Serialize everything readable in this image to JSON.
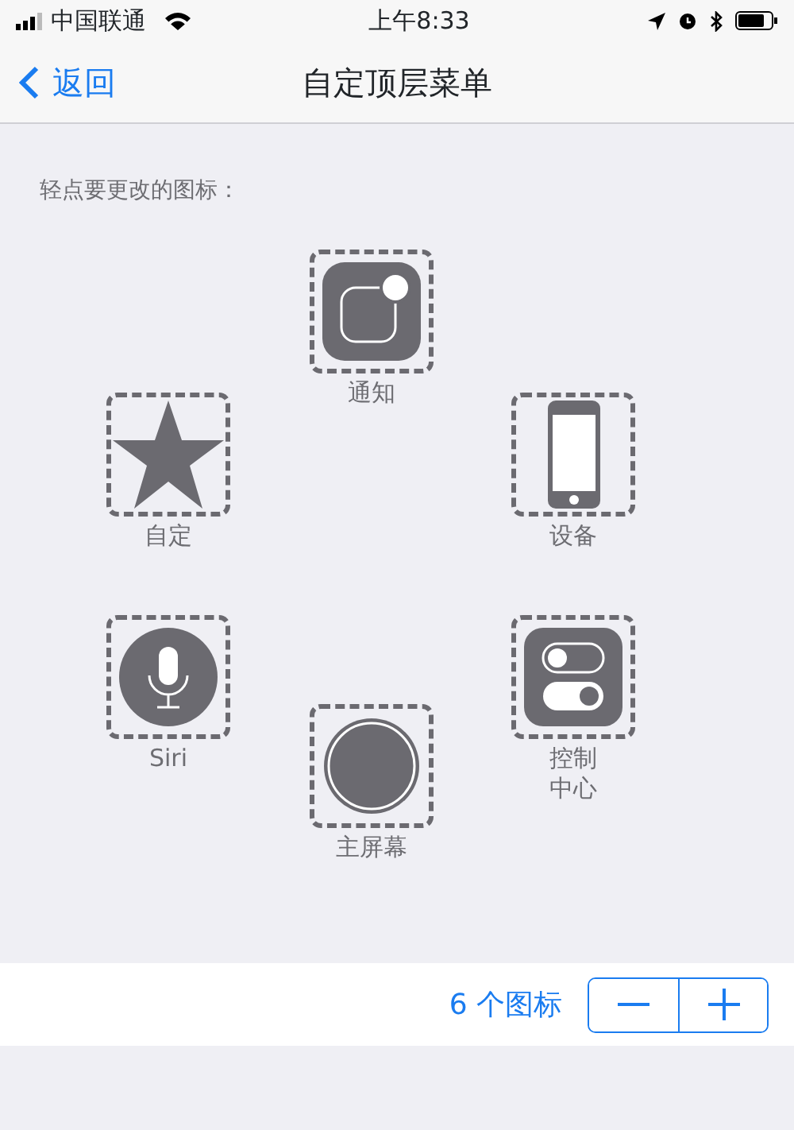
{
  "status_bar": {
    "carrier": "中国联通",
    "time": "上午8:33"
  },
  "nav_bar": {
    "back": "返回",
    "title": "自定顶层菜单"
  },
  "hint": "轻点要更改的图标：",
  "icons": [
    {
      "kind": "notification",
      "label": "通知"
    },
    {
      "kind": "star",
      "label": "自定"
    },
    {
      "kind": "device",
      "label": "设备"
    },
    {
      "kind": "siri",
      "label": "Siri"
    },
    {
      "kind": "home",
      "label": "主屏幕"
    },
    {
      "kind": "control",
      "label": "控制中心"
    }
  ],
  "footer": {
    "count": "6 个图标"
  }
}
